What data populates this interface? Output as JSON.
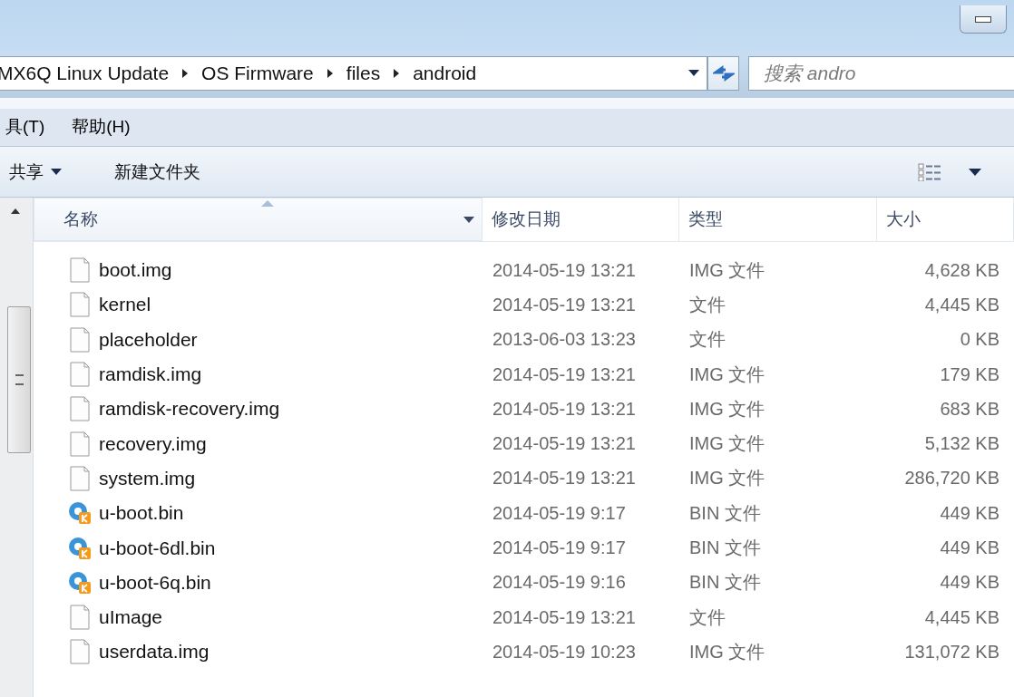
{
  "breadcrumb": [
    "MX6Q Linux Update",
    "OS Firmware",
    "files",
    "android"
  ],
  "search": {
    "placeholder": "搜索 andro"
  },
  "menu": [
    "具(T)",
    "帮助(H)"
  ],
  "toolbar": [
    {
      "label": "共享",
      "dropdown": true
    },
    {
      "label": "新建文件夹",
      "dropdown": false
    }
  ],
  "columns": [
    {
      "label": "名称",
      "sorted": true
    },
    {
      "label": "修改日期",
      "sorted": false
    },
    {
      "label": "类型",
      "sorted": false
    },
    {
      "label": "大小",
      "sorted": false
    }
  ],
  "files": [
    {
      "name": "boot.img",
      "kind": "file",
      "date": "2014-05-19 13:21",
      "type": "IMG 文件",
      "size": "4,628 KB"
    },
    {
      "name": "kernel",
      "kind": "file",
      "date": "2014-05-19 13:21",
      "type": "文件",
      "size": "4,445 KB"
    },
    {
      "name": "placeholder",
      "kind": "file",
      "date": "2013-06-03 13:23",
      "type": "文件",
      "size": "0 KB"
    },
    {
      "name": "ramdisk.img",
      "kind": "file",
      "date": "2014-05-19 13:21",
      "type": "IMG 文件",
      "size": "179 KB"
    },
    {
      "name": "ramdisk-recovery.img",
      "kind": "file",
      "date": "2014-05-19 13:21",
      "type": "IMG 文件",
      "size": "683 KB"
    },
    {
      "name": "recovery.img",
      "kind": "file",
      "date": "2014-05-19 13:21",
      "type": "IMG 文件",
      "size": "5,132 KB"
    },
    {
      "name": "system.img",
      "kind": "file",
      "date": "2014-05-19 13:21",
      "type": "IMG 文件",
      "size": "286,720 KB"
    },
    {
      "name": "u-boot.bin",
      "kind": "bin",
      "date": "2014-05-19 9:17",
      "type": "BIN 文件",
      "size": "449 KB"
    },
    {
      "name": "u-boot-6dl.bin",
      "kind": "bin",
      "date": "2014-05-19 9:17",
      "type": "BIN 文件",
      "size": "449 KB"
    },
    {
      "name": "u-boot-6q.bin",
      "kind": "bin",
      "date": "2014-05-19 9:16",
      "type": "BIN 文件",
      "size": "449 KB"
    },
    {
      "name": "uImage",
      "kind": "file",
      "date": "2014-05-19 13:21",
      "type": "文件",
      "size": "4,445 KB"
    },
    {
      "name": "userdata.img",
      "kind": "file",
      "date": "2014-05-19 10:23",
      "type": "IMG 文件",
      "size": "131,072 KB"
    }
  ]
}
